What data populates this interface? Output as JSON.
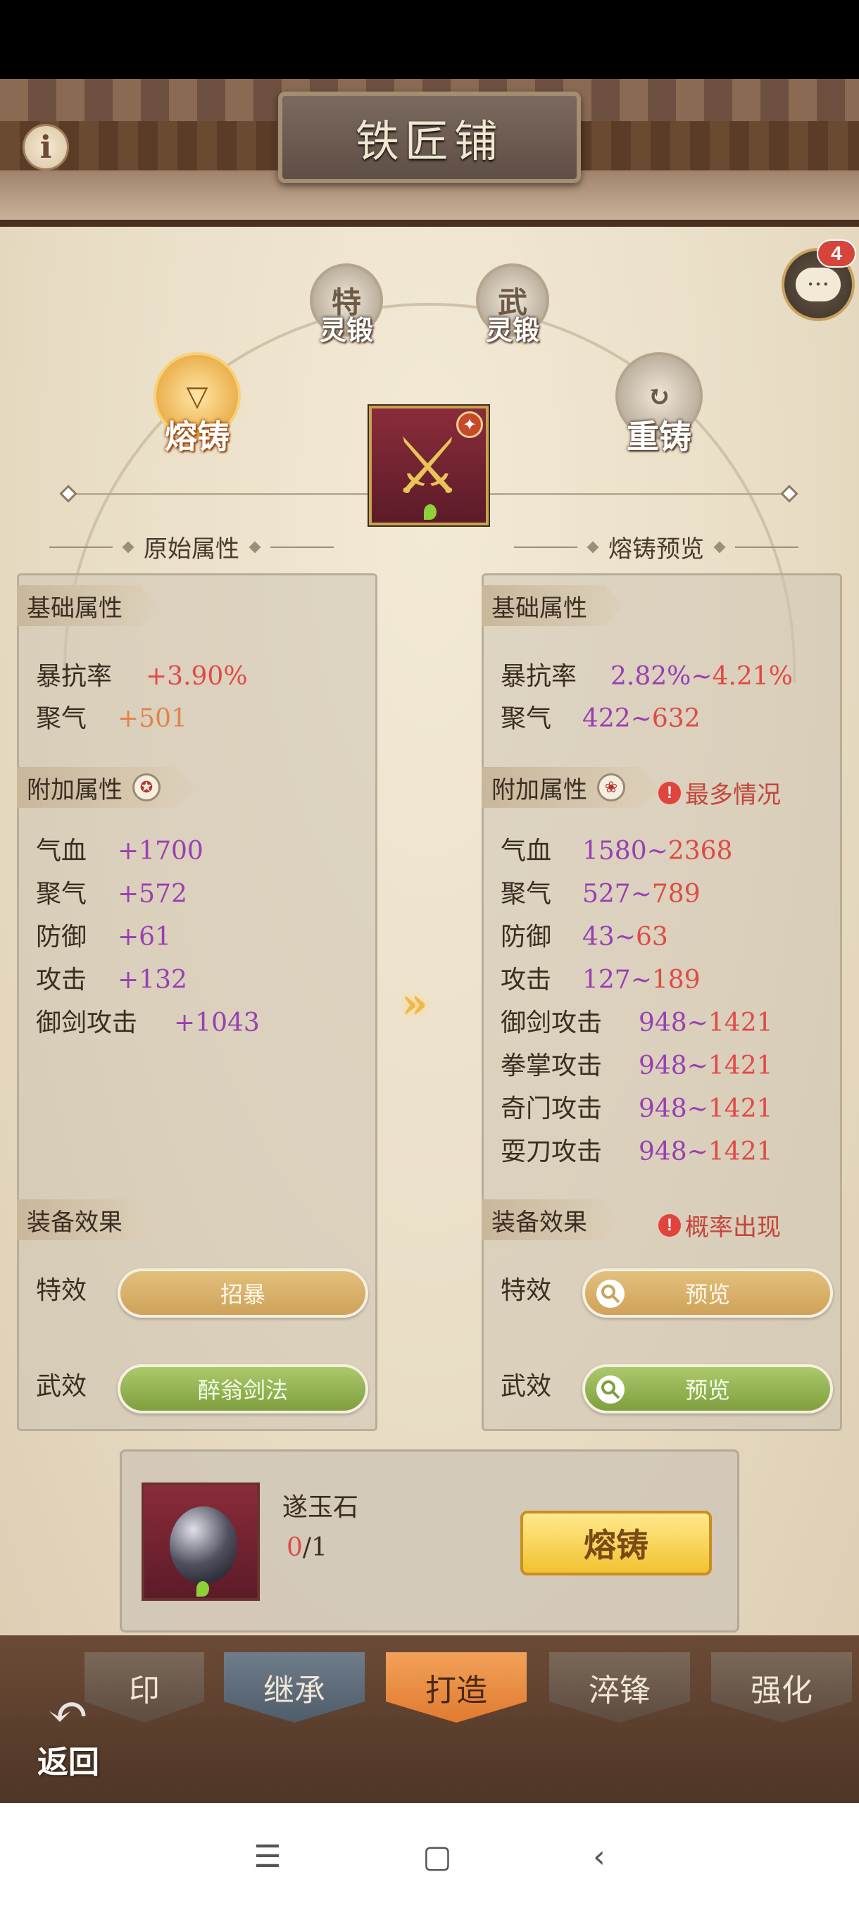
{
  "header": {
    "title": "铁匠铺"
  },
  "chat": {
    "badge": "4"
  },
  "modes": {
    "rongzhu": "熔铸",
    "chongzhu": "重铸",
    "te_icon": "特",
    "te_label": "灵锻",
    "wu_icon": "武",
    "wu_label": "灵锻"
  },
  "left": {
    "title": "原始属性",
    "basic_tag": "基础属性",
    "basic": [
      {
        "k": "暴抗率",
        "v": "+3.90%"
      },
      {
        "k": "聚气",
        "v": "+501"
      }
    ],
    "extra_tag": "附加属性",
    "extra": [
      {
        "k": "气血",
        "v": "+1700"
      },
      {
        "k": "聚气",
        "v": "+572"
      },
      {
        "k": "防御",
        "v": "+61"
      },
      {
        "k": "攻击",
        "v": "+132"
      },
      {
        "k": "御剑攻击",
        "v": "+1043"
      }
    ],
    "effect_tag": "装备效果",
    "effect1_label": "特效",
    "effect1_value": "招暴",
    "effect2_label": "武效",
    "effect2_value": "醉翁剑法"
  },
  "right": {
    "title": "熔铸预览",
    "basic_tag": "基础属性",
    "basic": [
      {
        "k": "暴抗率",
        "min": "2.82%",
        "sep": "~",
        "max": "4.21%"
      },
      {
        "k": "聚气",
        "min": "422",
        "sep": "~",
        "max": "632"
      }
    ],
    "extra_tag": "附加属性",
    "extra_warn": "最多情况",
    "extra": [
      {
        "k": "气血",
        "min": "1580",
        "sep": "~",
        "max": "2368"
      },
      {
        "k": "聚气",
        "min": "527",
        "sep": "~",
        "max": "789"
      },
      {
        "k": "防御",
        "min": "43",
        "sep": "~",
        "max": "63"
      },
      {
        "k": "攻击",
        "min": "127",
        "sep": "~",
        "max": "189"
      },
      {
        "k": "御剑攻击",
        "min": "948",
        "sep": "~",
        "max": "1421"
      },
      {
        "k": "拳掌攻击",
        "min": "948",
        "sep": "~",
        "max": "1421"
      },
      {
        "k": "奇门攻击",
        "min": "948",
        "sep": "~",
        "max": "1421"
      },
      {
        "k": "耍刀攻击",
        "min": "948",
        "sep": "~",
        "max": "1421"
      }
    ],
    "effect_tag": "装备效果",
    "effect_warn": "概率出现",
    "effect1_label": "特效",
    "effect1_value": "预览",
    "effect2_label": "武效",
    "effect2_value": "预览"
  },
  "material": {
    "name": "遂玉石",
    "have": "0",
    "need": "/1",
    "button": "熔铸"
  },
  "nav": {
    "tabs": [
      "印",
      "继承",
      "打造",
      "淬锋",
      "强化"
    ],
    "back": "返回"
  },
  "colors": {
    "accent": "#e07b2f",
    "red": "#e04a45",
    "purple": "#9a3fb3"
  }
}
